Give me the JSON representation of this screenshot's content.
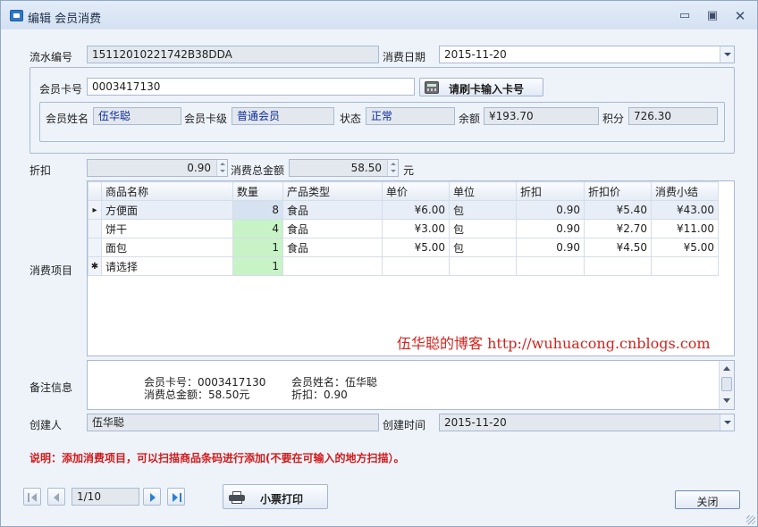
{
  "window": {
    "title": "编辑 会员消费"
  },
  "form": {
    "serial_label": "流水编号",
    "serial_value": "15112010221742B38DDA",
    "date_label": "消费日期",
    "date_value": "2015-11-20",
    "card_label": "会员卡号",
    "card_value": "0003417130",
    "card_button": "请刷卡输入卡号",
    "name_label": "会员姓名",
    "name_value": "伍华聪",
    "level_label": "会员卡级",
    "level_value": "普通会员",
    "status_label": "状态",
    "status_value": "正常",
    "balance_label": "余额",
    "balance_value": "¥193.70",
    "points_label": "积分",
    "points_value": "726.30",
    "discount_label": "折扣",
    "discount_value": "0.90",
    "total_label": "消费总金额",
    "total_value": "58.50",
    "total_unit": "元",
    "items_label": "消费项目",
    "notes_label": "备注信息",
    "creator_label": "创建人",
    "creator_value": "伍华聪",
    "created_label": "创建时间",
    "created_value": "2015-11-20"
  },
  "grid": {
    "columns": [
      "商品名称",
      "数量",
      "产品类型",
      "单价",
      "单位",
      "折扣",
      "折扣价",
      "消费小结"
    ],
    "rows": [
      {
        "indicator": "▸",
        "cells": [
          "方便面",
          "8",
          "食品",
          "¥6.00",
          "包",
          "0.90",
          "¥5.40",
          "¥43.00"
        ]
      },
      {
        "indicator": "",
        "cells": [
          "饼干",
          "4",
          "食品",
          "¥3.00",
          "包",
          "0.90",
          "¥2.70",
          "¥11.00"
        ]
      },
      {
        "indicator": "",
        "cells": [
          "面包",
          "1",
          "食品",
          "¥5.00",
          "包",
          "0.90",
          "¥4.50",
          "¥5.00"
        ]
      },
      {
        "indicator": "✱",
        "cells": [
          "请选择",
          "1",
          "",
          "",
          "",
          "",
          "",
          ""
        ]
      }
    ]
  },
  "watermark": "伍华聪的博客 http://wuhuacong.cnblogs.com",
  "notes": {
    "line1_left": "会员卡号：0003417130",
    "line1_right": "会员姓名：伍华聪",
    "line2_left": "消费总金额：58.50元",
    "line2_right": "折扣：0.90"
  },
  "hint": "说明：添加消费项目，可以扫描商品条码进行添加(不要在可输入的地方扫描）。",
  "footer": {
    "page_indicator": "1/10",
    "print_button": "小票打印",
    "close_button": "关闭"
  }
}
